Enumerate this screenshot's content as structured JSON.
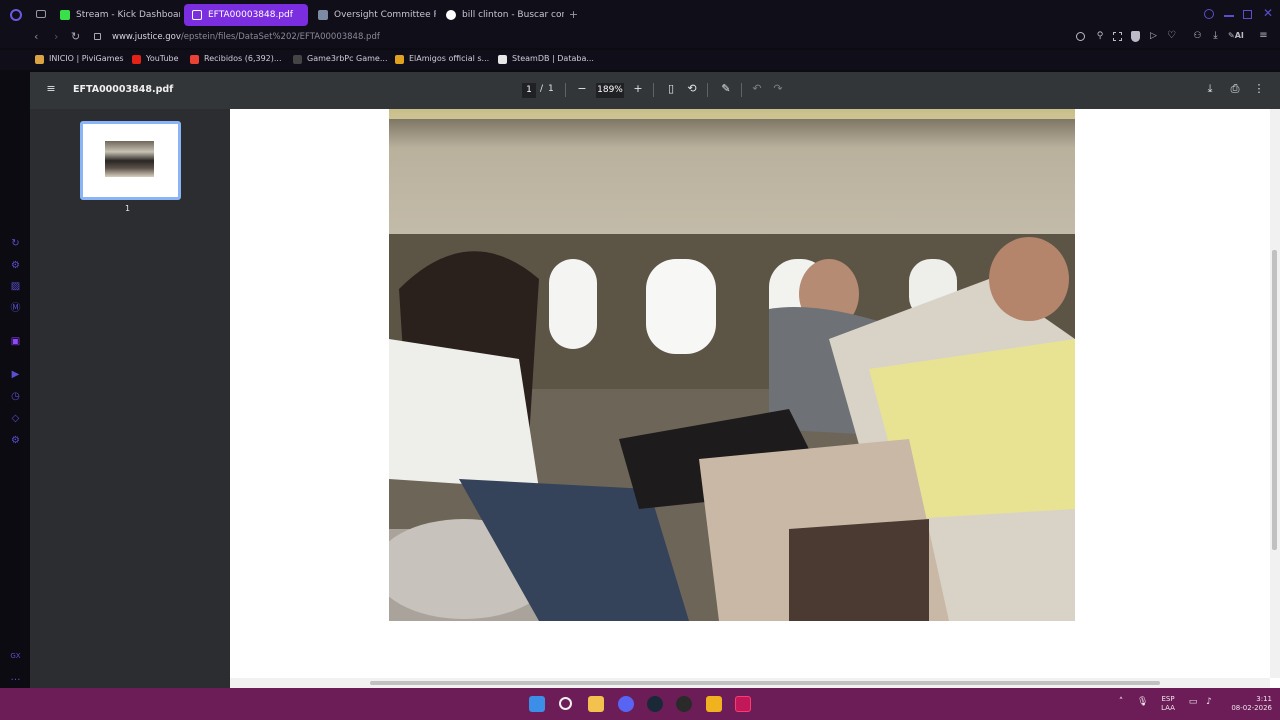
{
  "tabs": [
    {
      "label": "Stream - Kick Dashboard",
      "active": false
    },
    {
      "label": "EFTA00003848.pdf",
      "active": true
    },
    {
      "label": "Oversight Committee Rele",
      "active": false
    },
    {
      "label": "bill clinton - Buscar con G",
      "active": false
    }
  ],
  "address": {
    "host": "www.justice.gov",
    "path": "/epstein/files/DataSet%202/EFTA00003848.pdf"
  },
  "bookmarks": [
    "INICIO | PiviGames",
    "YouTube",
    "Recibidos (6,392)...",
    "Game3rbPc Game...",
    "ElAmigos official s...",
    "SteamDB | Databa..."
  ],
  "pdf": {
    "filename": "EFTA00003848.pdf",
    "page_current": "1",
    "page_separator": "/",
    "page_total": "1",
    "zoom": "189%",
    "thumb_label": "1"
  },
  "taskbar": {
    "lang_top": "ESP",
    "lang_bottom": "LAA",
    "time": "3:11",
    "date": "08-02-2026"
  },
  "colors": {
    "accent": "#7a2ee0",
    "taskbar": "#6c1d57",
    "pdf_toolbar": "#323639"
  }
}
